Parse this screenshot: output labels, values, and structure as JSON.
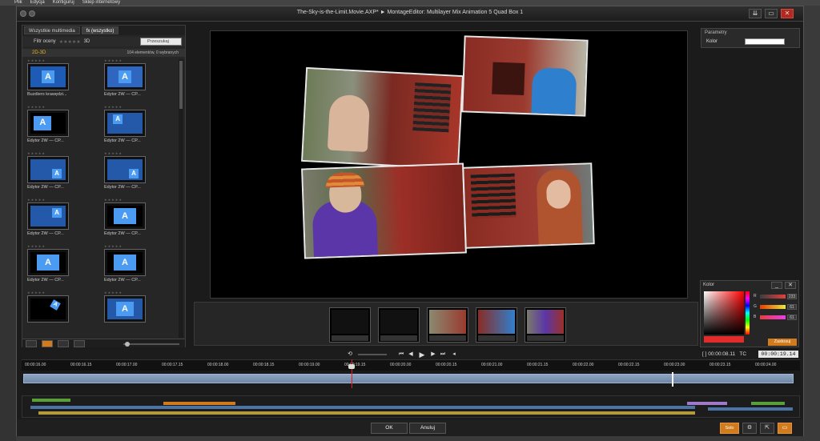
{
  "menubar": {
    "items": [
      "Plik",
      "Edycja",
      "Konfiguruj",
      "Sklep internetowy"
    ]
  },
  "dialog": {
    "title": "The-Sky-is-the-Limit.Movie.AXP* ► MontageEditor: Multilayer Mix Animation 5 Quad Box 1",
    "window_buttons": [
      "⇊",
      "▭",
      "✕"
    ]
  },
  "library": {
    "tabs": [
      "Wszystkie multimedia",
      "fx (wszystko)"
    ],
    "filter_label": "Filtr oceny",
    "filter_stars": "★★★★★",
    "mode_3d": "3D",
    "search_placeholder": "Przeszukaj",
    "category": "2D-3D",
    "count": "104 elementów, 0 wybranych",
    "items": [
      {
        "label": "Buzdiero krawędzi..."
      },
      {
        "label": "Edytor 2W — CP..."
      },
      {
        "label": "Edytor 2W — CP..."
      },
      {
        "label": "Edytor 2W — CP..."
      },
      {
        "label": "Edytor 2W — CP..."
      },
      {
        "label": "Edytor 2W — CP..."
      },
      {
        "label": "Edytor 2W — CP..."
      },
      {
        "label": "Edytor 2W — CP..."
      },
      {
        "label": "Edytor 2W — CP..."
      },
      {
        "label": "Edytor 2W — CP..."
      },
      {
        "label": ""
      },
      {
        "label": ""
      }
    ]
  },
  "params": {
    "title": "Parametry",
    "color_label": "Kolor"
  },
  "color_panel": {
    "title": "Kolor",
    "r_label": "R",
    "r_value": "233",
    "g_label": "G",
    "g_value": "61",
    "b_label": "B",
    "b_value": "61",
    "apply_label": "Zastosuj",
    "selected_color": "#e93d3d"
  },
  "transport": {
    "tc_label": "[ ] 00:00:08.11   TC",
    "tc_value": "00:00:19.14"
  },
  "ruler": {
    "ticks": [
      "00:00:16.00",
      "00:00:16.15",
      "00:00:17.00",
      "00:00:17.15",
      "00:00:18.00",
      "00:00:18.15",
      "00:00:19.00",
      "00:00:19.15",
      "00:00:20.00",
      "00:00:20.15",
      "00:00:21.00",
      "00:00:21.15",
      "00:00:22.00",
      "00:00:22.15",
      "00:00:23.00",
      "00:00:23.15",
      "00:00:24.00"
    ]
  },
  "footer": {
    "ok_label": "OK",
    "cancel_label": "Anuluj",
    "solo_label": "Solo"
  },
  "colors": {
    "accent": "#d17b1c",
    "close": "#b4291f",
    "track": "#8ea6c4"
  }
}
